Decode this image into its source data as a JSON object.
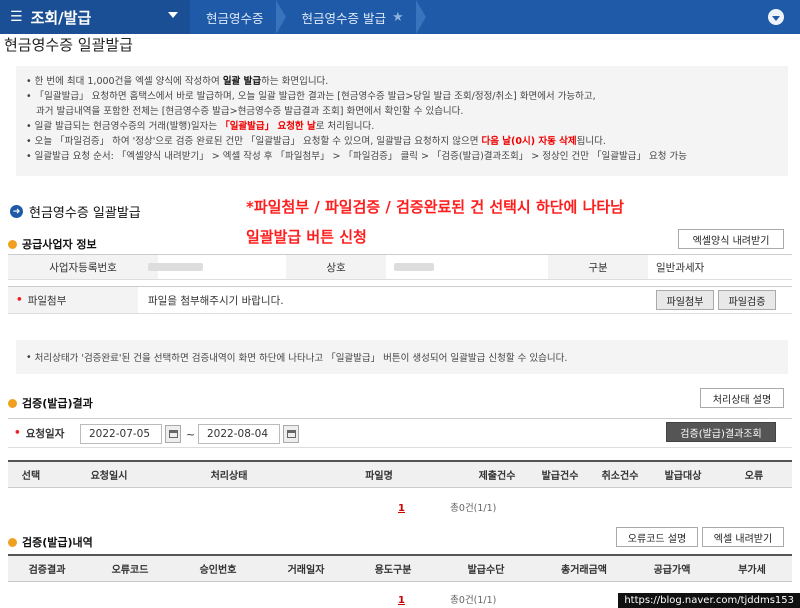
{
  "nav": {
    "menu_label": "조회/발급",
    "crumbs": [
      "현금영수증",
      "현금영수증 발급"
    ]
  },
  "page_title": "현금영수증 일괄발급",
  "notice": {
    "l1a": "한 번에 최대 1,000건을 엑셀 양식에 작성하여 ",
    "l1b": "일괄 발급",
    "l1c": "하는 화면입니다.",
    "l2": "「일괄발급」 요청하면 홈택스에서 바로 발급하며, 오늘 일괄 발급한 결과는 [현금영수증 발급>당일 발급 조회/정정/취소] 화면에서 가능하고,",
    "l3": "과거 발급내역을 포함한 전체는 [현금영수증 발급>현금영수증 발급결과 조회] 화면에서 확인할 수 있습니다.",
    "l4a": "일괄 발급되는 현금영수증의 거래(발행)일자는 ",
    "l4b": "「일괄발급」 요청한 날",
    "l4c": "로 처리됩니다.",
    "l5a": "오늘 「파일검증」 하여 '정상'으로 검증 완료된 건만 「일괄발급」 요청할 수 있으며, 일괄발급 요청하지 않으면 ",
    "l5b": "다음 날(0시) 자동 삭제",
    "l5c": "됩니다.",
    "l6": "일괄발급 요청 순서: 「엑셀양식 내려받기」 > 엑셀 작성 후 「파일첨부」 > 「파일검증」 클릭 > 「검증(발급)결과조회」 > 정상인 건만 「일괄발급」 요청 가능"
  },
  "section_title": "현금영수증 일괄발급",
  "annotation": {
    "line1": "*파일첨부 / 파일검증 / 검증완료된 건 선택시 하단에 나타남",
    "line2": "일괄발급 버튼 신청"
  },
  "supplier": {
    "title": "공급사업자 정보",
    "excel_btn": "엑셀양식 내려받기",
    "reg_label": "사업자등록번호",
    "name_label": "상호",
    "type_label": "구분",
    "type_value": "일반과세자"
  },
  "file": {
    "label": "파일첨부",
    "placeholder": "파일을 첨부해주시기 바랍니다.",
    "attach_btn": "파일첨부",
    "verify_btn": "파일검증"
  },
  "notice2": "처리상태가 '검증완료'된 건을 선택하면 검증내역이 화면 하단에 나타나고 「일괄발급」 버튼이 생성되어 일괄발급 신청할 수 있습니다.",
  "result": {
    "title": "검증(발급)결과",
    "status_btn": "처리상태 설명",
    "date_label": "요청일자",
    "date_from": "2022-07-05",
    "tilde": "~",
    "date_to": "2022-08-04",
    "query_btn": "검증(발급)결과조회",
    "columns": [
      "선택",
      "요청일시",
      "처리상태",
      "파일명",
      "제출건수",
      "발급건수",
      "취소건수",
      "발급대상",
      "오류"
    ],
    "page": "1",
    "total": "총0건(1/1)"
  },
  "detail": {
    "title": "검증(발급)내역",
    "error_btn": "오류코드 설명",
    "excel_btn": "엑셀 내려받기",
    "columns": [
      "검증결과",
      "오류코드",
      "승인번호",
      "거래일자",
      "용도구분",
      "발급수단",
      "총거래금액",
      "공급가액",
      "부가세"
    ],
    "page": "1",
    "total": "총0건(1/1)"
  },
  "watermark": "https://blog.naver.com/tjddms153"
}
